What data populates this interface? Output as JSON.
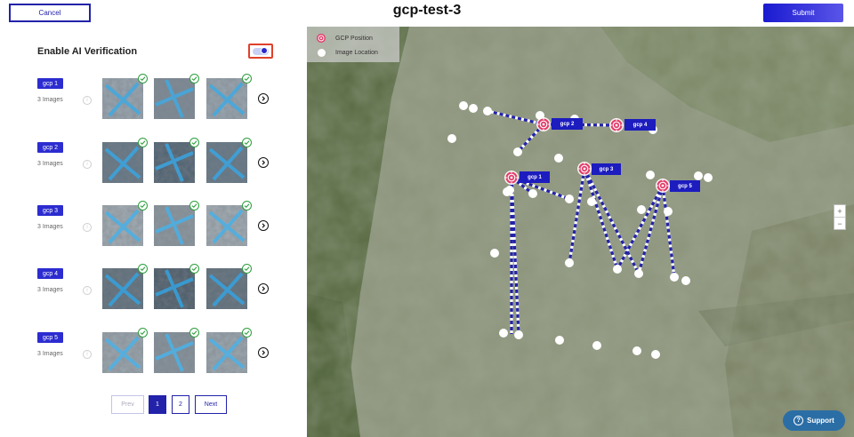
{
  "header": {
    "title": "gcp-test-3",
    "cancel_label": "Cancel",
    "submit_label": "Submit"
  },
  "ai_verification": {
    "label": "Enable AI Verification",
    "enabled": true
  },
  "gcps": [
    {
      "name": "gcp 1",
      "images_label": "3 Images"
    },
    {
      "name": "gcp 2",
      "images_label": "3 Images"
    },
    {
      "name": "gcp 3",
      "images_label": "3 Images"
    },
    {
      "name": "gcp 4",
      "images_label": "3 Images"
    },
    {
      "name": "gcp 5",
      "images_label": "3 Images"
    }
  ],
  "pagination": {
    "prev_label": "Prev",
    "pages": [
      "1",
      "2"
    ],
    "current": "1",
    "next_label": "Next"
  },
  "map": {
    "legend": {
      "gcp_position": "GCP Position",
      "image_location": "Image Location"
    },
    "gcp_labels": [
      "gcp 1",
      "gcp 2",
      "gcp 3",
      "gcp 4",
      "gcp 5"
    ],
    "zoom_in": "+",
    "zoom_out": "−"
  },
  "support_label": "Support",
  "colors": {
    "accent": "#2222aa",
    "badge": "#2c2cd0",
    "verified": "#2e9e3e",
    "toggle_highlight": "#e0402a",
    "support": "#2b6ea6"
  },
  "icons": {
    "check": "check-circle-icon",
    "info": "info-icon",
    "next": "chevron-right-circle-icon",
    "gcp_marker": "crosshair-target-icon",
    "support": "question-circle-icon"
  }
}
